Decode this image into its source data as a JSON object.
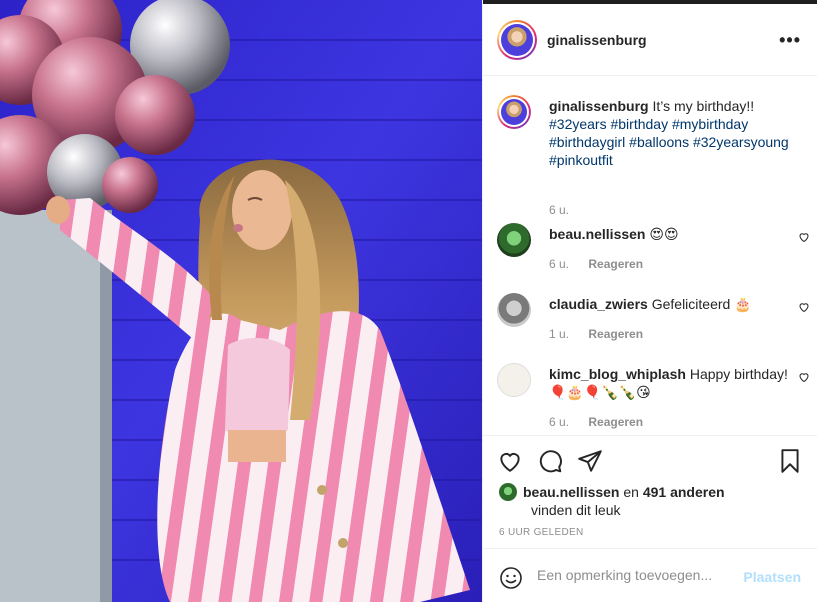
{
  "post": {
    "author": "ginalissenburg",
    "more_icon": "more-dots-icon",
    "caption_text": "It’s my birthday!!",
    "hashtags_line1": "#32years #birthday #mybirthday",
    "hashtags_line2": "#birthdaygirl #balloons #32yearsyoung",
    "hashtags_line3": "#pinkoutfit",
    "caption_time": "6 u."
  },
  "comments": [
    {
      "user": "beau.nellissen",
      "text": "😍😍",
      "time": "6 u.",
      "reply": "Reageren"
    },
    {
      "user": "claudia_zwiers",
      "text": "Gefeliciteerd 🎂",
      "time": "1 u.",
      "reply": "Reageren"
    },
    {
      "user": "kimc_blog_whiplash",
      "text": "Happy birthday! 🎈🎂🎈🍾🍾😘",
      "time": "6 u.",
      "reply": "Reageren"
    }
  ],
  "likes": {
    "liker": "beau.nellissen",
    "connector": "en",
    "others": "491 anderen",
    "suffix": "vinden dit leuk"
  },
  "timestamp": "6 UUR GELEDEN",
  "add_comment": {
    "placeholder": "Een opmerking toevoegen...",
    "post_label": "Plaatsen"
  },
  "colors": {
    "hashtag": "#00376b",
    "muted": "#8e8e8e",
    "post_button": "#b2dffc",
    "wall": "#3a2fd6"
  }
}
